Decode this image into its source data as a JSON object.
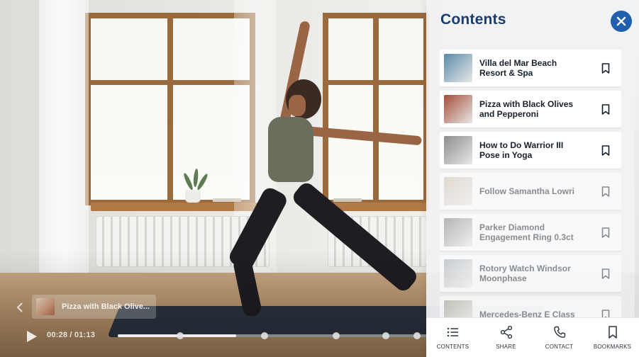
{
  "player": {
    "current_chapter": "Pizza with Black Olive...",
    "time_current": "00:28",
    "time_separator": " / ",
    "time_total": "01:13",
    "progress_fraction": 0.38,
    "chapter_markers": [
      0.2,
      0.47,
      0.7,
      0.86,
      0.96
    ]
  },
  "panel": {
    "title": "Contents",
    "items": [
      {
        "label": "Villa del Mar Beach Resort & Spa",
        "dimmed": false,
        "thumb_color": "#5a8aa8"
      },
      {
        "label": "Pizza with Black Olives and Pepperoni",
        "dimmed": false,
        "thumb_color": "#a54c38"
      },
      {
        "label": "How to Do Warrior III Pose in Yoga",
        "dimmed": false,
        "thumb_color": "#8d8d90"
      },
      {
        "label": "Follow Samantha Lowri",
        "dimmed": true,
        "thumb_color": "#c9b8a6"
      },
      {
        "label": "Parker Diamond Engagement Ring 0.3ct",
        "dimmed": true,
        "thumb_color": "#6f6f6f"
      },
      {
        "label": "Rotory Watch Windsor Moonphase",
        "dimmed": true,
        "thumb_color": "#9aa0a6"
      },
      {
        "label": "Mercedes-Benz E Class",
        "dimmed": true,
        "thumb_color": "#8a8c78"
      }
    ]
  },
  "toolbar": {
    "contents": "CONTENTS",
    "share": "SHARE",
    "contact": "CONTACT",
    "bookmarks": "BOOKMARKS"
  },
  "colors": {
    "accent": "#1f5fae",
    "title": "#1a3d6b"
  },
  "icons": [
    "play-icon",
    "chevron-left-icon",
    "close-icon",
    "bookmark-icon",
    "list-icon",
    "share-icon",
    "phone-icon",
    "bookmark-tab-icon"
  ]
}
